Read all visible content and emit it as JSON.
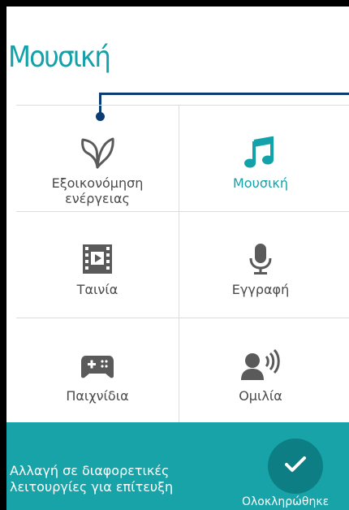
{
  "header": {
    "title": "Μουσική"
  },
  "modes": [
    {
      "label": "Εξοικονόμηση\nενέργειας",
      "icon": "leaf-icon",
      "active": false
    },
    {
      "label": "Μουσική",
      "icon": "music-note-icon",
      "active": true
    },
    {
      "label": "Ταινία",
      "icon": "film-icon",
      "active": false
    },
    {
      "label": "Εγγραφή",
      "icon": "microphone-icon",
      "active": false
    },
    {
      "label": "Παιχνίδια",
      "icon": "gamepad-icon",
      "active": false
    },
    {
      "label": "Ομιλία",
      "icon": "speaker-voice-icon",
      "active": false
    }
  ],
  "footer": {
    "hint": "Αλλαγή σε διαφορετικές\nλειτουργίες για επίτευξη",
    "done_label": "Ολοκληρώθηκε",
    "done_icon": "checkmark-icon"
  },
  "colors": {
    "accent": "#13a2a9",
    "bar": "#17a3a8",
    "button": "#0d7e84",
    "pointer": "#0b3d74",
    "icon": "#5a5a5a"
  }
}
